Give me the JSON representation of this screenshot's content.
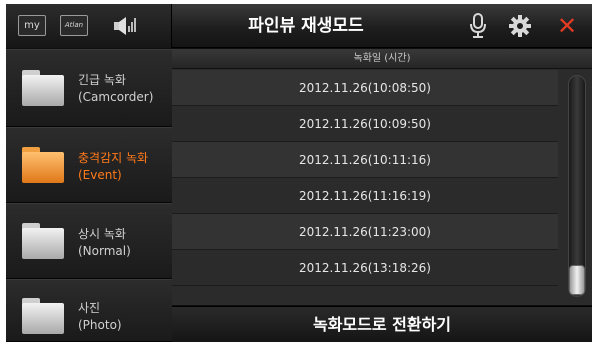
{
  "topbar": {
    "my_label": "my",
    "atlan_label": "Atlan",
    "title": "파인뷰 재생모드",
    "icons": {
      "speaker": "speaker-icon",
      "mic": "microphone-icon",
      "settings": "gear-icon",
      "close": "close-icon"
    },
    "close_glyph": "✕",
    "close_color": "#e23b24"
  },
  "sidebar": {
    "items": [
      {
        "line1": "긴급 녹화",
        "line2": "(Camcorder)",
        "active": false,
        "folder_color": "grey"
      },
      {
        "line1": "충격감지 녹화",
        "line2": "(Event)",
        "active": true,
        "folder_color": "orange"
      },
      {
        "line1": "상시 녹화",
        "line2": "(Normal)",
        "active": false,
        "folder_color": "grey"
      },
      {
        "line1": "사진",
        "line2": "(Photo)",
        "active": false,
        "folder_color": "grey"
      }
    ],
    "active_color": "#ff7a1a"
  },
  "list": {
    "header": "녹화일 (시간)",
    "rows": [
      "2012.11.26(10:08:50)",
      "2012.11.26(10:09:50)",
      "2012.11.26(10:11:16)",
      "2012.11.26(11:16:19)",
      "2012.11.26(11:23:00)",
      "2012.11.26(13:18:26)"
    ]
  },
  "bottom": {
    "switch_label": "녹화모드로 전환하기"
  }
}
